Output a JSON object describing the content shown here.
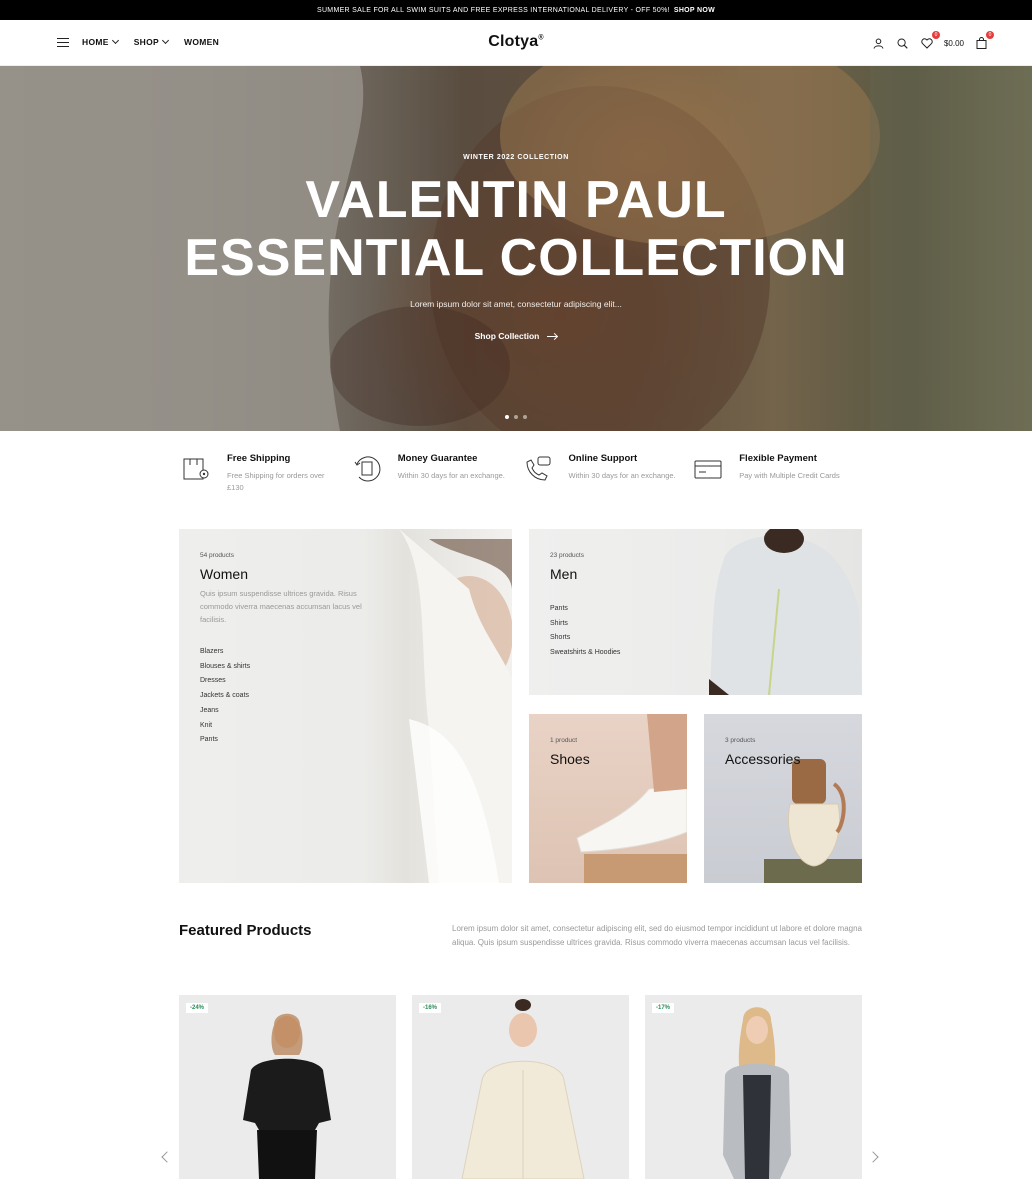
{
  "announcement": {
    "text": "SUMMER SALE FOR ALL SWIM SUITS AND FREE EXPRESS INTERNATIONAL DELIVERY - OFF 50%!",
    "link": "SHOP NOW"
  },
  "header": {
    "nav": [
      "HOME",
      "SHOP",
      "WOMEN"
    ],
    "logo": "Clotya",
    "logo_mark": "®",
    "wishlist_count": "0",
    "cart_total": "$0.00",
    "cart_count": "0"
  },
  "hero": {
    "eyebrow": "WINTER 2022 COLLECTION",
    "title_line1": "VALENTIN PAUL",
    "title_line2": "ESSENTIAL COLLECTION",
    "description": "Lorem ipsum dolor sit amet, consectetur adipiscing elit...",
    "cta": "Shop Collection",
    "slides": 3,
    "active_slide": 1
  },
  "features": [
    {
      "title": "Free Shipping",
      "text": "Free Shipping for orders over £130",
      "icon": "box-location-icon"
    },
    {
      "title": "Money Guarantee",
      "text": "Within 30 days for an exchange.",
      "icon": "money-refresh-icon"
    },
    {
      "title": "Online Support",
      "text": "Within 30 days for an exchange.",
      "icon": "phone-support-icon"
    },
    {
      "title": "Flexible Payment",
      "text": "Pay with Multiple Credit Cards",
      "icon": "credit-card-icon"
    }
  ],
  "categories": {
    "women": {
      "count": "54 products",
      "name": "Women",
      "description": "Quis ipsum suspendisse ultrices gravida. Risus commodo viverra maecenas accumsan lacus vel facilisis.",
      "items": [
        "Blazers",
        "Blouses & shirts",
        "Dresses",
        "Jackets & coats",
        "Jeans",
        "Knit",
        "Pants"
      ]
    },
    "men": {
      "count": "23 products",
      "name": "Men",
      "items": [
        "Pants",
        "Shirts",
        "Shorts",
        "Sweatshirts & Hoodies"
      ]
    },
    "shoes": {
      "count": "1 product",
      "name": "Shoes"
    },
    "accessories": {
      "count": "3 products",
      "name": "Accessories"
    }
  },
  "featured": {
    "title": "Featured Products",
    "description": "Lorem ipsum dolor sit amet, consectetur adipiscing elit, sed do eiusmod tempor incididunt ut labore et dolore magna aliqua. Quis ipsum suspendisse ultrices gravida. Risus commodo viverra maecenas accumsan lacus vel facilisis.",
    "products": [
      {
        "discount": "-24%"
      },
      {
        "discount": "-16%"
      },
      {
        "discount": "-17%"
      }
    ]
  },
  "colors": {
    "badge": "#e43d3d",
    "discount": "#2a8b56",
    "topbar": "#000000"
  }
}
